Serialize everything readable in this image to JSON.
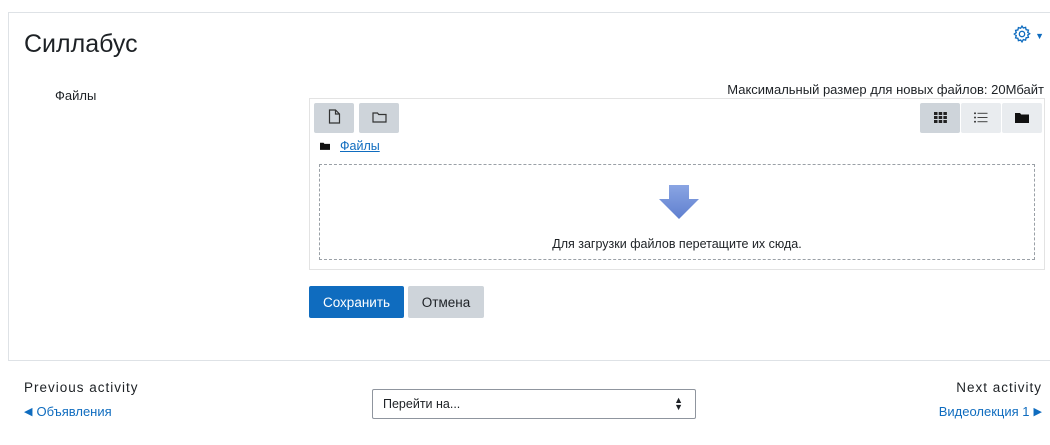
{
  "page": {
    "title": "Силлабус"
  },
  "form": {
    "field_label": "Файлы",
    "max_size_text": "Максимальный размер для новых файлов: 20Мбайт",
    "path_link": "Файлы",
    "drop_text": "Для загрузки файлов перетащите их сюда.",
    "save_label": "Сохранить",
    "cancel_label": "Отмена"
  },
  "icons": {
    "settings": "gear-icon",
    "add_file": "file-icon",
    "create_folder": "folder-outline-icon",
    "view_icons": "grid-icon",
    "view_list": "list-icon",
    "view_tree": "folder-icon",
    "path_folder": "folder-icon",
    "drop": "arrow-down-icon"
  },
  "footer": {
    "prev_label": "Previous activity",
    "prev_link": "Объявления",
    "next_label": "Next activity",
    "next_link": "Видеолекция 1",
    "jump_placeholder": "Перейти на..."
  },
  "colors": {
    "primary": "#0f6cbf",
    "secondary": "#ced4da",
    "drop_arrow": "#6f8fd6"
  }
}
